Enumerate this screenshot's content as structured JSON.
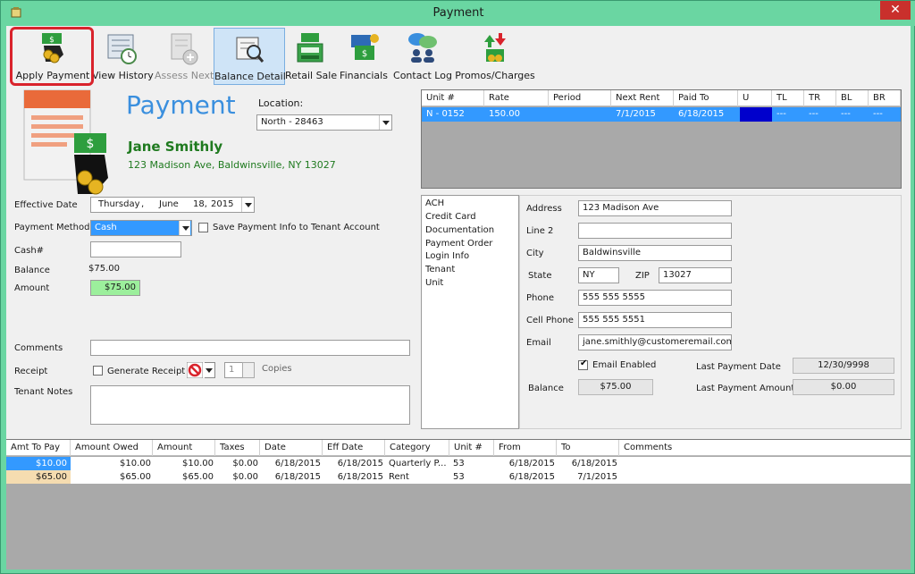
{
  "window": {
    "title": "Payment",
    "close_glyph": "✕"
  },
  "toolbar": [
    {
      "key": "apply_payment",
      "label": "Apply Payment",
      "icon": "money-hand-icon"
    },
    {
      "key": "view_history",
      "label": "View History",
      "icon": "history-icon"
    },
    {
      "key": "assess_next",
      "label": "Assess Next",
      "icon": "assess-next-icon"
    },
    {
      "key": "balance_detail",
      "label": "Balance Detail",
      "icon": "balance-detail-icon"
    },
    {
      "key": "retail_sale",
      "label": "Retail Sale",
      "icon": "cash-register-icon"
    },
    {
      "key": "financials",
      "label": "Financials",
      "icon": "financials-icon"
    },
    {
      "key": "contact_log",
      "label": "Contact Log",
      "icon": "contact-log-icon"
    },
    {
      "key": "promos",
      "label": "Promos/Charges",
      "icon": "promos-icon"
    }
  ],
  "header": {
    "title": "Payment",
    "location_label": "Location:",
    "location_value": "North - 28463",
    "tenant_name": "Jane Smithly",
    "tenant_address": "123 Madison Ave, Baldwinsville, NY  13027"
  },
  "units": {
    "columns": [
      "Unit #",
      "Rate",
      "Period",
      "Next Rent",
      "Paid To",
      "U",
      "TL",
      "TR",
      "BL",
      "BR"
    ],
    "rows": [
      {
        "unit": "N - 0152",
        "rate": "150.00",
        "period": "",
        "next_rent": "7/1/2015",
        "paid_to": "6/18/2015",
        "u": "",
        "tl": "---",
        "tr": "---",
        "bl": "---",
        "br": "---"
      }
    ]
  },
  "form": {
    "effective_date_label": "Effective Date",
    "effective_date_day": "Thursday",
    "effective_date_sep": ",",
    "effective_date_month": "June",
    "effective_date_dd": "18,",
    "effective_date_year": "2015",
    "payment_method_label": "Payment Method",
    "payment_method_value": "Cash",
    "save_payment_label": "Save Payment Info to Tenant Account",
    "cash_no_label": "Cash#",
    "cash_no_value": "",
    "balance_label": "Balance",
    "balance_value": "$75.00",
    "amount_label": "Amount",
    "amount_value": "$75.00",
    "comments_label": "Comments",
    "comments_value": "",
    "receipt_label": "Receipt",
    "generate_receipt_label": "Generate Receipt",
    "copies_value": "1",
    "copies_label": "Copies",
    "tenant_notes_label": "Tenant Notes"
  },
  "tenant_tabs": [
    "ACH",
    "Credit Card",
    "Documentation",
    "Payment Order",
    "Login Info",
    "Tenant",
    "Unit"
  ],
  "tenant": {
    "address_label": "Address",
    "address_value": "123 Madison Ave",
    "line2_label": "Line 2",
    "line2_value": "",
    "city_label": "City",
    "city_value": "Baldwinsville",
    "state_label": "State",
    "state_value": "NY",
    "zip_label": "ZIP",
    "zip_value": "13027",
    "phone_label": "Phone",
    "phone_value": "555 555 5555",
    "cell_label": "Cell Phone",
    "cell_value": "555 555 5551",
    "email_label": "Email",
    "email_value": "jane.smithly@customeremail.com",
    "email_enabled_label": "Email Enabled",
    "balance_label": "Balance",
    "balance_value": "$75.00",
    "last_payment_date_label": "Last Payment Date",
    "last_payment_date_value": "12/30/9998",
    "last_payment_amount_label": "Last Payment Amount",
    "last_payment_amount_value": "$0.00"
  },
  "charges": {
    "columns": [
      "Amt To Pay",
      "Amount Owed",
      "Amount",
      "Taxes",
      "Date",
      "Eff Date",
      "Category",
      "Unit #",
      "From",
      "To",
      "Comments"
    ],
    "rows": [
      {
        "amt_to_pay": "$10.00",
        "amount_owed": "$10.00",
        "amount": "$10.00",
        "taxes": "$0.00",
        "date": "6/18/2015",
        "eff_date": "6/18/2015",
        "category": "Quarterly P...",
        "unit": "53",
        "from": "6/18/2015",
        "to": "6/18/2015",
        "comments": ""
      },
      {
        "amt_to_pay": "$65.00",
        "amount_owed": "$65.00",
        "amount": "$65.00",
        "taxes": "$0.00",
        "date": "6/18/2015",
        "eff_date": "6/18/2015",
        "category": "Rent",
        "unit": "53",
        "from": "6/18/2015",
        "to": "7/1/2015",
        "comments": ""
      }
    ]
  },
  "colors": {
    "title_blue": "#3a8fde",
    "name_green": "#1f7a1f",
    "select_blue": "#3399ff",
    "amount_green": "#9cef9c",
    "titlebar": "#6ad6a2"
  }
}
